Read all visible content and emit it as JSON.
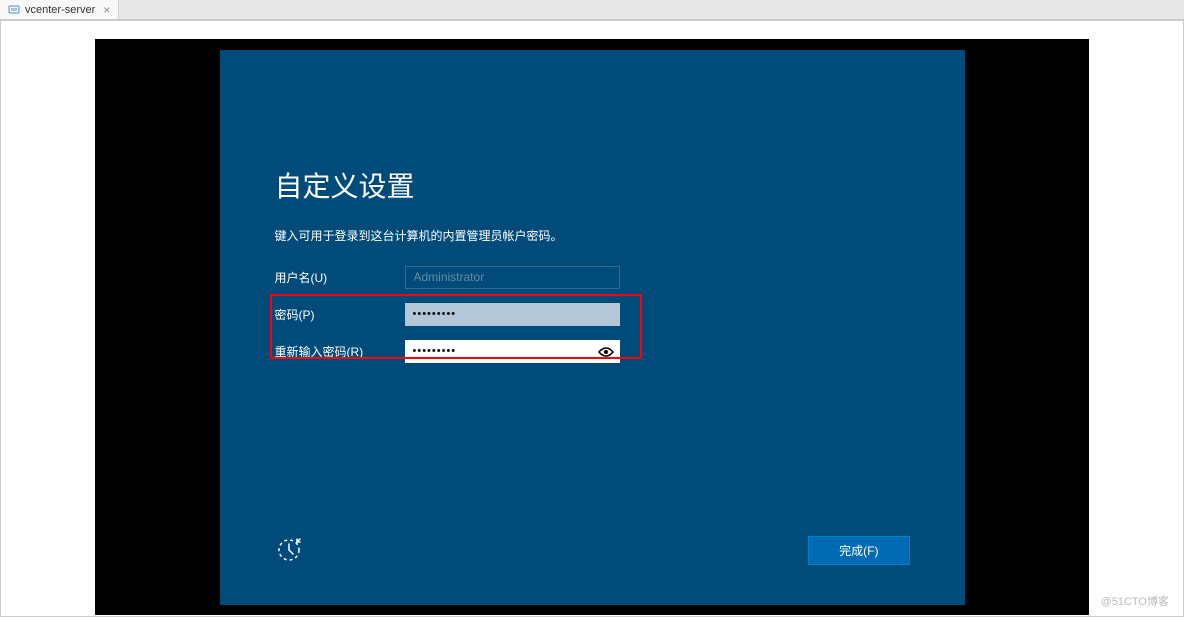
{
  "tab": {
    "title": "vcenter-server"
  },
  "installer": {
    "title": "自定义设置",
    "instruction": "键入可用于登录到这台计算机的内置管理员帐户密码。",
    "username_label": "用户名(U)",
    "username_value": "Administrator",
    "password_label": "密码(P)",
    "password_value": "•••••••••",
    "confirm_label": "重新输入密码(R)",
    "confirm_value": "•••••••••",
    "finish_button": "完成(F)"
  },
  "watermark": "@51CTO博客"
}
